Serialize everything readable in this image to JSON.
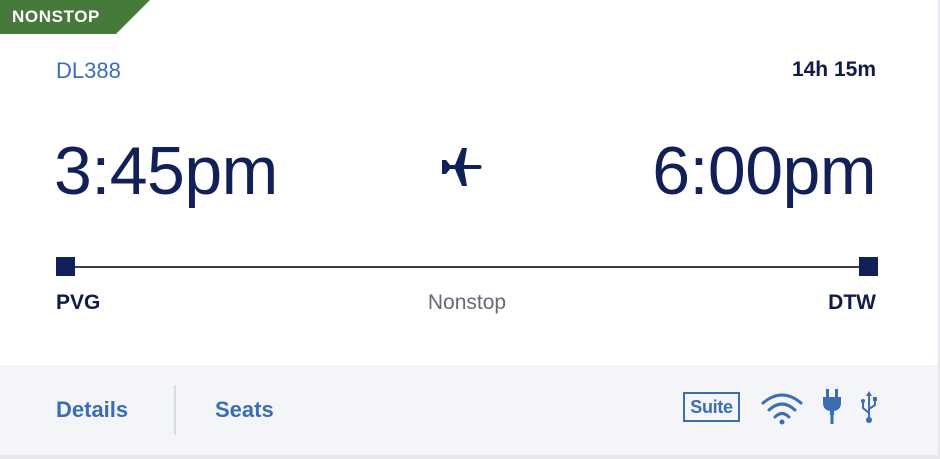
{
  "badge": {
    "label": "NONSTOP",
    "color": "#457a3a"
  },
  "flight": {
    "number": "DL388",
    "duration": "14h 15m",
    "departure_time": "3:45pm",
    "arrival_time": "6:00pm",
    "origin": "PVG",
    "destination": "DTW",
    "stops": "Nonstop"
  },
  "footer": {
    "details_label": "Details",
    "seats_label": "Seats",
    "cabin_label": "Suite",
    "amenities": [
      "wifi-icon",
      "power-icon",
      "usb-icon"
    ]
  },
  "colors": {
    "navy": "#12205a",
    "link_blue": "#3b6db5",
    "footer_bg": "#f4f5f9"
  }
}
